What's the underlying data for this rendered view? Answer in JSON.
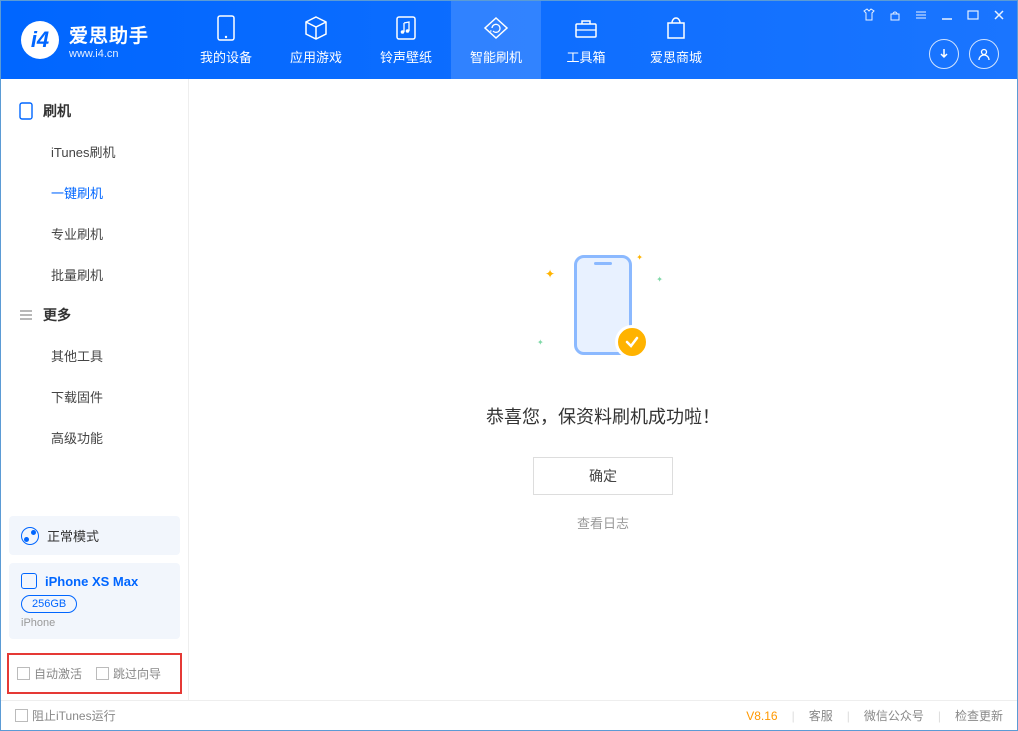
{
  "app": {
    "title": "爱思助手",
    "subtitle": "www.i4.cn"
  },
  "topTabs": [
    {
      "label": "我的设备",
      "icon": "device"
    },
    {
      "label": "应用游戏",
      "icon": "cube"
    },
    {
      "label": "铃声壁纸",
      "icon": "music"
    },
    {
      "label": "智能刷机",
      "icon": "refresh",
      "active": true
    },
    {
      "label": "工具箱",
      "icon": "toolbox"
    },
    {
      "label": "爱思商城",
      "icon": "bag"
    }
  ],
  "sidebar": {
    "flashSection": "刷机",
    "flashItems": [
      {
        "label": "iTunes刷机"
      },
      {
        "label": "一键刷机",
        "active": true
      },
      {
        "label": "专业刷机"
      },
      {
        "label": "批量刷机"
      }
    ],
    "moreSection": "更多",
    "moreItems": [
      {
        "label": "其他工具"
      },
      {
        "label": "下载固件"
      },
      {
        "label": "高级功能"
      }
    ],
    "mode": "正常模式",
    "device": {
      "name": "iPhone XS Max",
      "storage": "256GB",
      "type": "iPhone"
    },
    "autoActivate": "自动激活",
    "skipGuide": "跳过向导"
  },
  "content": {
    "successText": "恭喜您，保资料刷机成功啦！",
    "okButton": "确定",
    "viewLog": "查看日志"
  },
  "footer": {
    "blockItunes": "阻止iTunes运行",
    "version": "V8.16",
    "service": "客服",
    "wechat": "微信公众号",
    "update": "检查更新"
  }
}
